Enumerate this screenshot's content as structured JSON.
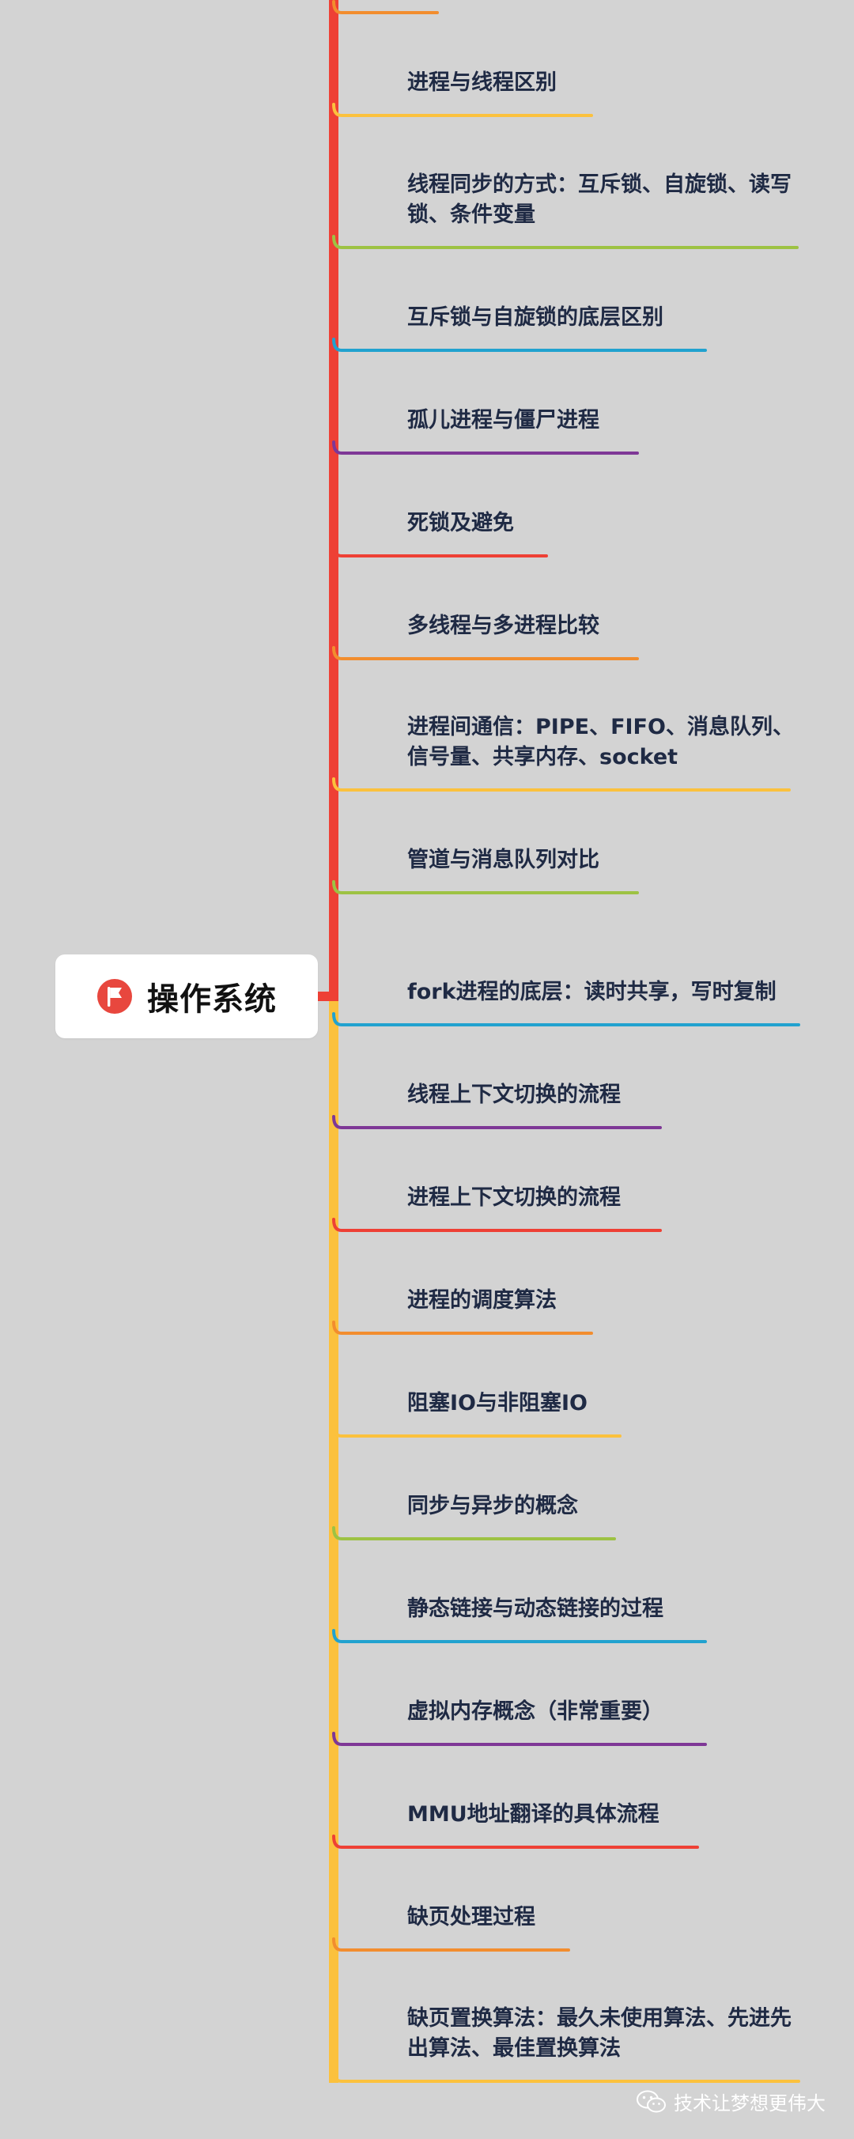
{
  "root": {
    "title": "操作系统",
    "icon": "flag-icon",
    "icon_color": "#e8473e"
  },
  "spine_colors": {
    "upper": "#ee4035",
    "lower": "#fbc13d"
  },
  "branches": [
    {
      "label": "",
      "color": "#f28d2e"
    },
    {
      "label": "进程与线程区别",
      "color": "#fbc13d"
    },
    {
      "label": "线程同步的方式：互斥锁、自旋锁、读写锁、条件变量",
      "color": "#9dc243"
    },
    {
      "label": "互斥锁与自旋锁的底层区别",
      "color": "#21a2cf"
    },
    {
      "label": "孤儿进程与僵尸进程",
      "color": "#7e3796"
    },
    {
      "label": "死锁及避免",
      "color": "#ee4035"
    },
    {
      "label": "多线程与多进程比较",
      "color": "#f28d2e"
    },
    {
      "label": "进程间通信：PIPE、FIFO、消息队列、信号量、共享内存、socket",
      "color": "#fbc13d"
    },
    {
      "label": "管道与消息队列对比",
      "color": "#9dc243"
    },
    {
      "label": "fork进程的底层：读时共享，写时复制",
      "color": "#21a2cf"
    },
    {
      "label": "线程上下文切换的流程",
      "color": "#7e3796"
    },
    {
      "label": "进程上下文切换的流程",
      "color": "#ee4035"
    },
    {
      "label": "进程的调度算法",
      "color": "#f28d2e"
    },
    {
      "label": "阻塞IO与非阻塞IO",
      "color": "#fbc13d"
    },
    {
      "label": "同步与异步的概念",
      "color": "#9dc243"
    },
    {
      "label": "静态链接与动态链接的过程",
      "color": "#21a2cf"
    },
    {
      "label": "虚拟内存概念（非常重要）",
      "color": "#7e3796"
    },
    {
      "label": "MMU地址翻译的具体流程",
      "color": "#ee4035"
    },
    {
      "label": "缺页处理过程",
      "color": "#f28d2e"
    },
    {
      "label": "缺页置换算法：最久未使用算法、先进先出算法、最佳置换算法",
      "color": "#fbc13d"
    }
  ],
  "watermark": {
    "text": "技术让梦想更伟大",
    "icon": "wechat-icon"
  }
}
